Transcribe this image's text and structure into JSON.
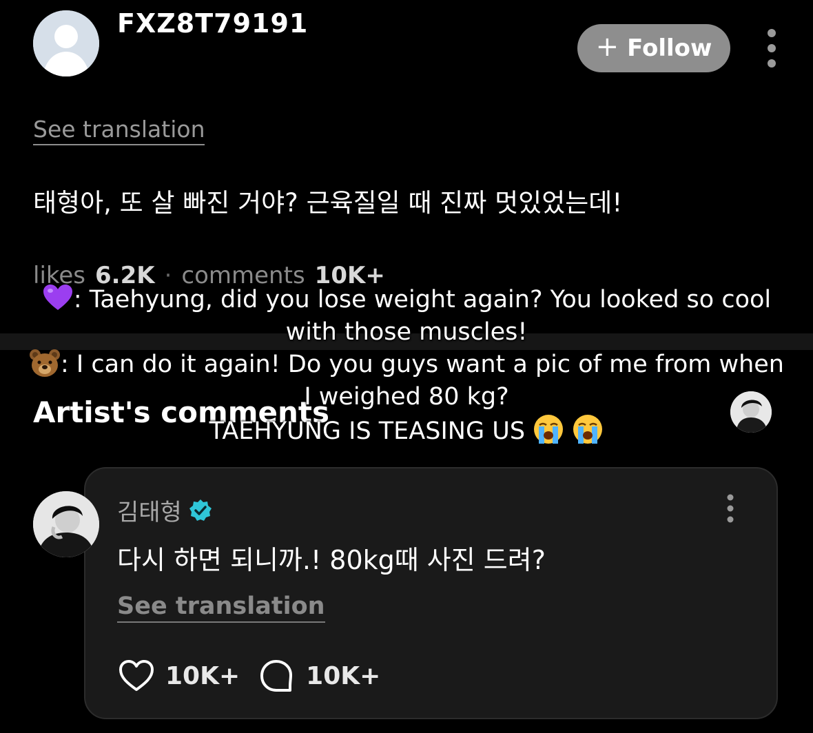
{
  "header": {
    "username": "FXZ8T79191",
    "follow_label": "Follow"
  },
  "post": {
    "see_translation": "See translation",
    "text": "태형아, 또 살 빠진 거야? 근육질일 때 진짜 멋있었는데!",
    "likes_label": "likes",
    "likes_count": "6.2K",
    "comments_label": "comments",
    "comments_count": "10K+"
  },
  "section": {
    "artist_comments_title": "Artist's comments"
  },
  "captions": {
    "line1": ": Taehyung, did you lose weight again? You looked so cool",
    "line2": "with those muscles!",
    "line3": ": I can do it again! Do you guys want a pic of me from when",
    "line4": "I weighed 80 kg?",
    "line5": "TAEHYUNG IS TEASING US"
  },
  "comment": {
    "name": "김태형",
    "text": "다시 하면 되니까.! 80kg때 사진 드려?",
    "see_translation": "See translation",
    "likes": "10K+",
    "replies": "10K+"
  },
  "colors": {
    "background": "#000000",
    "follow_button": "#8e8e8e",
    "verified_badge": "#2fc6d8",
    "card_background": "#1a1a1a"
  }
}
